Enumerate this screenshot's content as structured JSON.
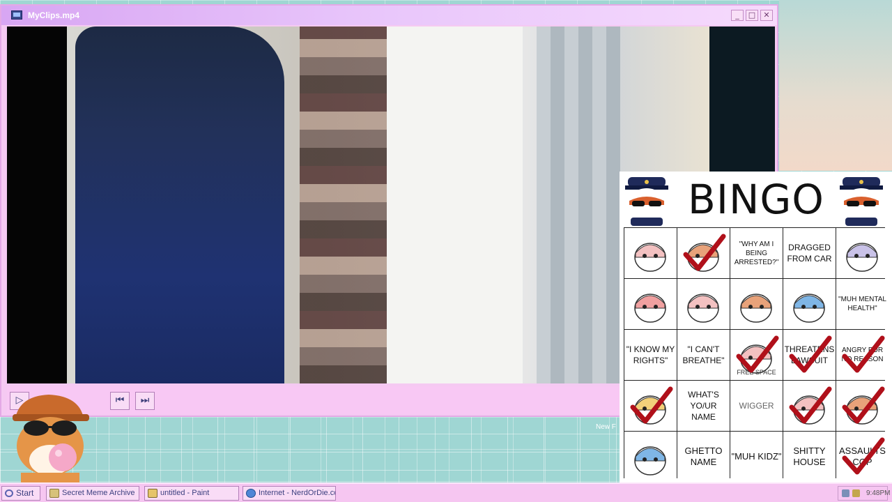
{
  "window": {
    "title": "MyClips.mp4",
    "minimize_glyph": "_",
    "maximize_glyph": "□",
    "close_glyph": "✕",
    "icons": {
      "app": "video-file-icon"
    }
  },
  "player": {
    "controls": [
      {
        "name": "play-button",
        "glyph": "▷",
        "icon": "play-icon"
      },
      {
        "name": "previous-button",
        "glyph": "⏮",
        "icon": "skip-back-icon"
      },
      {
        "name": "next-button",
        "glyph": "⏭",
        "icon": "skip-forward-icon"
      }
    ]
  },
  "desktop": {
    "partial_text": "New F"
  },
  "bingo": {
    "title": "BINGO",
    "free_label": "FREE SPACE",
    "cells": [
      {
        "text": "",
        "icon": "hijab-cat-sticker-icon",
        "checked": false
      },
      {
        "text": "",
        "icon": "woman-face-photo-icon",
        "checked": true
      },
      {
        "text": "\"WHY AM I BEING ARRESTED?\"",
        "checked": false
      },
      {
        "text": "DRAGGED FROM CAR",
        "checked": false
      },
      {
        "text": "",
        "icon": "sketch-figure-icon",
        "checked": false
      },
      {
        "text": "",
        "icon": "cartoon-person-icon",
        "checked": false
      },
      {
        "text": "",
        "icon": "driving-cat-icon",
        "checked": false
      },
      {
        "text": "",
        "icon": "crying-cartoon-icon",
        "checked": false
      },
      {
        "text": "",
        "icon": "angry-cat-icon",
        "checked": false
      },
      {
        "text": "\"MUH MENTAL HEALTH\"",
        "checked": false
      },
      {
        "text": "\"I KNOW MY RIGHTS\"",
        "checked": false
      },
      {
        "text": "\"I CAN'T BREATHE\"",
        "checked": false
      },
      {
        "text": "",
        "icon": "flag-cat-icon",
        "checked": true,
        "free": true
      },
      {
        "text": "THREATENS LAWSUIT",
        "checked": true
      },
      {
        "text": "ANGRY FOR NO REASON",
        "checked": true
      },
      {
        "text": "",
        "icon": "blonde-cartoon-icon",
        "checked": true
      },
      {
        "text": "WHAT'S YO/UR NAME",
        "checked": false
      },
      {
        "text": "WIGGER",
        "checked": false
      },
      {
        "text": "",
        "icon": "hooded-cat-icon",
        "checked": true
      },
      {
        "text": "",
        "icon": "yelling-cat-icon",
        "checked": true
      },
      {
        "text": "",
        "icon": "chubby-cat-icon",
        "checked": false
      },
      {
        "text": "GHETTO NAME",
        "checked": false
      },
      {
        "text": "\"MUH KIDZ\"",
        "checked": false
      },
      {
        "text": "SHITTY HOUSE",
        "checked": false
      },
      {
        "text": "ASSAULTS COP",
        "checked": true
      }
    ]
  },
  "taskbar": {
    "start_label": "Start",
    "tasks": [
      {
        "label": "Secret Meme Archive",
        "icon": "folder-icon"
      },
      {
        "label": "untitled - Paint",
        "icon": "paint-icon"
      },
      {
        "label": "Internet - NerdOrDie.com",
        "icon": "globe-icon"
      }
    ],
    "clock": "9:48PM",
    "tray_icons": [
      "network-icon",
      "speaker-icon"
    ]
  },
  "colors": {
    "accent_pink": "#f6c6f1",
    "title_purple": "#d8a6f3",
    "check_red": "#b0101a"
  }
}
